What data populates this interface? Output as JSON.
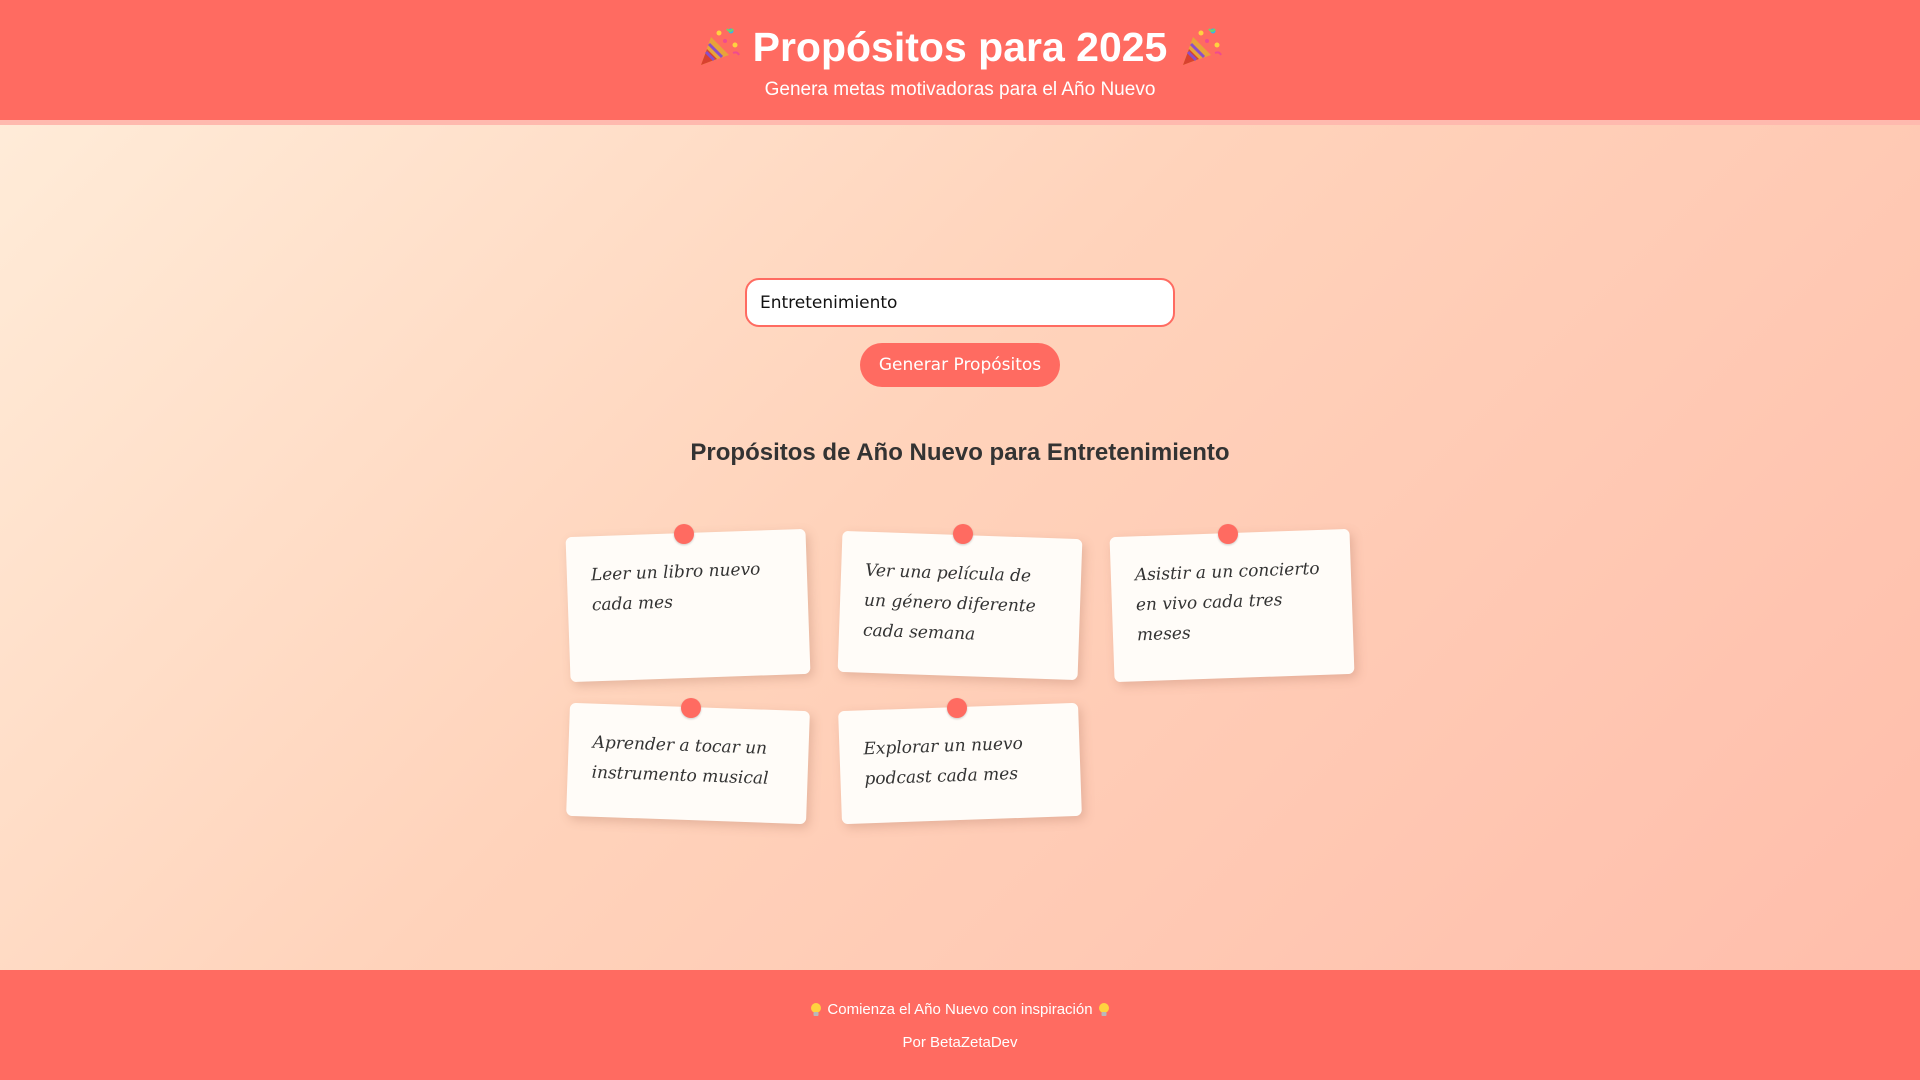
{
  "header": {
    "title": "Propósitos para 2025",
    "subtitle": "Genera metas motivadoras para el Año Nuevo",
    "icon_left": "party-popper-icon",
    "icon_right": "party-popper-icon"
  },
  "search": {
    "value": "Entretenimiento",
    "placeholder": ""
  },
  "generate_button": {
    "label": "Generar Propósitos"
  },
  "results": {
    "title": "Propósitos de Año Nuevo para Entretenimiento",
    "notes": [
      {
        "text": "Leer un libro nuevo cada mes"
      },
      {
        "text": "Ver una película de un género diferente cada semana"
      },
      {
        "text": "Asistir a un concierto en vivo cada tres meses"
      },
      {
        "text": "Aprender a tocar un instrumento musical"
      },
      {
        "text": "Explorar un nuevo podcast cada mes"
      }
    ]
  },
  "footer": {
    "tagline": "Comienza el Año Nuevo con inspiración",
    "credit": "Por BetaZetaDev",
    "icon": "lightbulb-icon"
  },
  "colors": {
    "accent": "#ff6b61",
    "note_bg": "#fffcf8",
    "bg_start": "#ffeedb",
    "bg_end": "#ffbcaa"
  }
}
